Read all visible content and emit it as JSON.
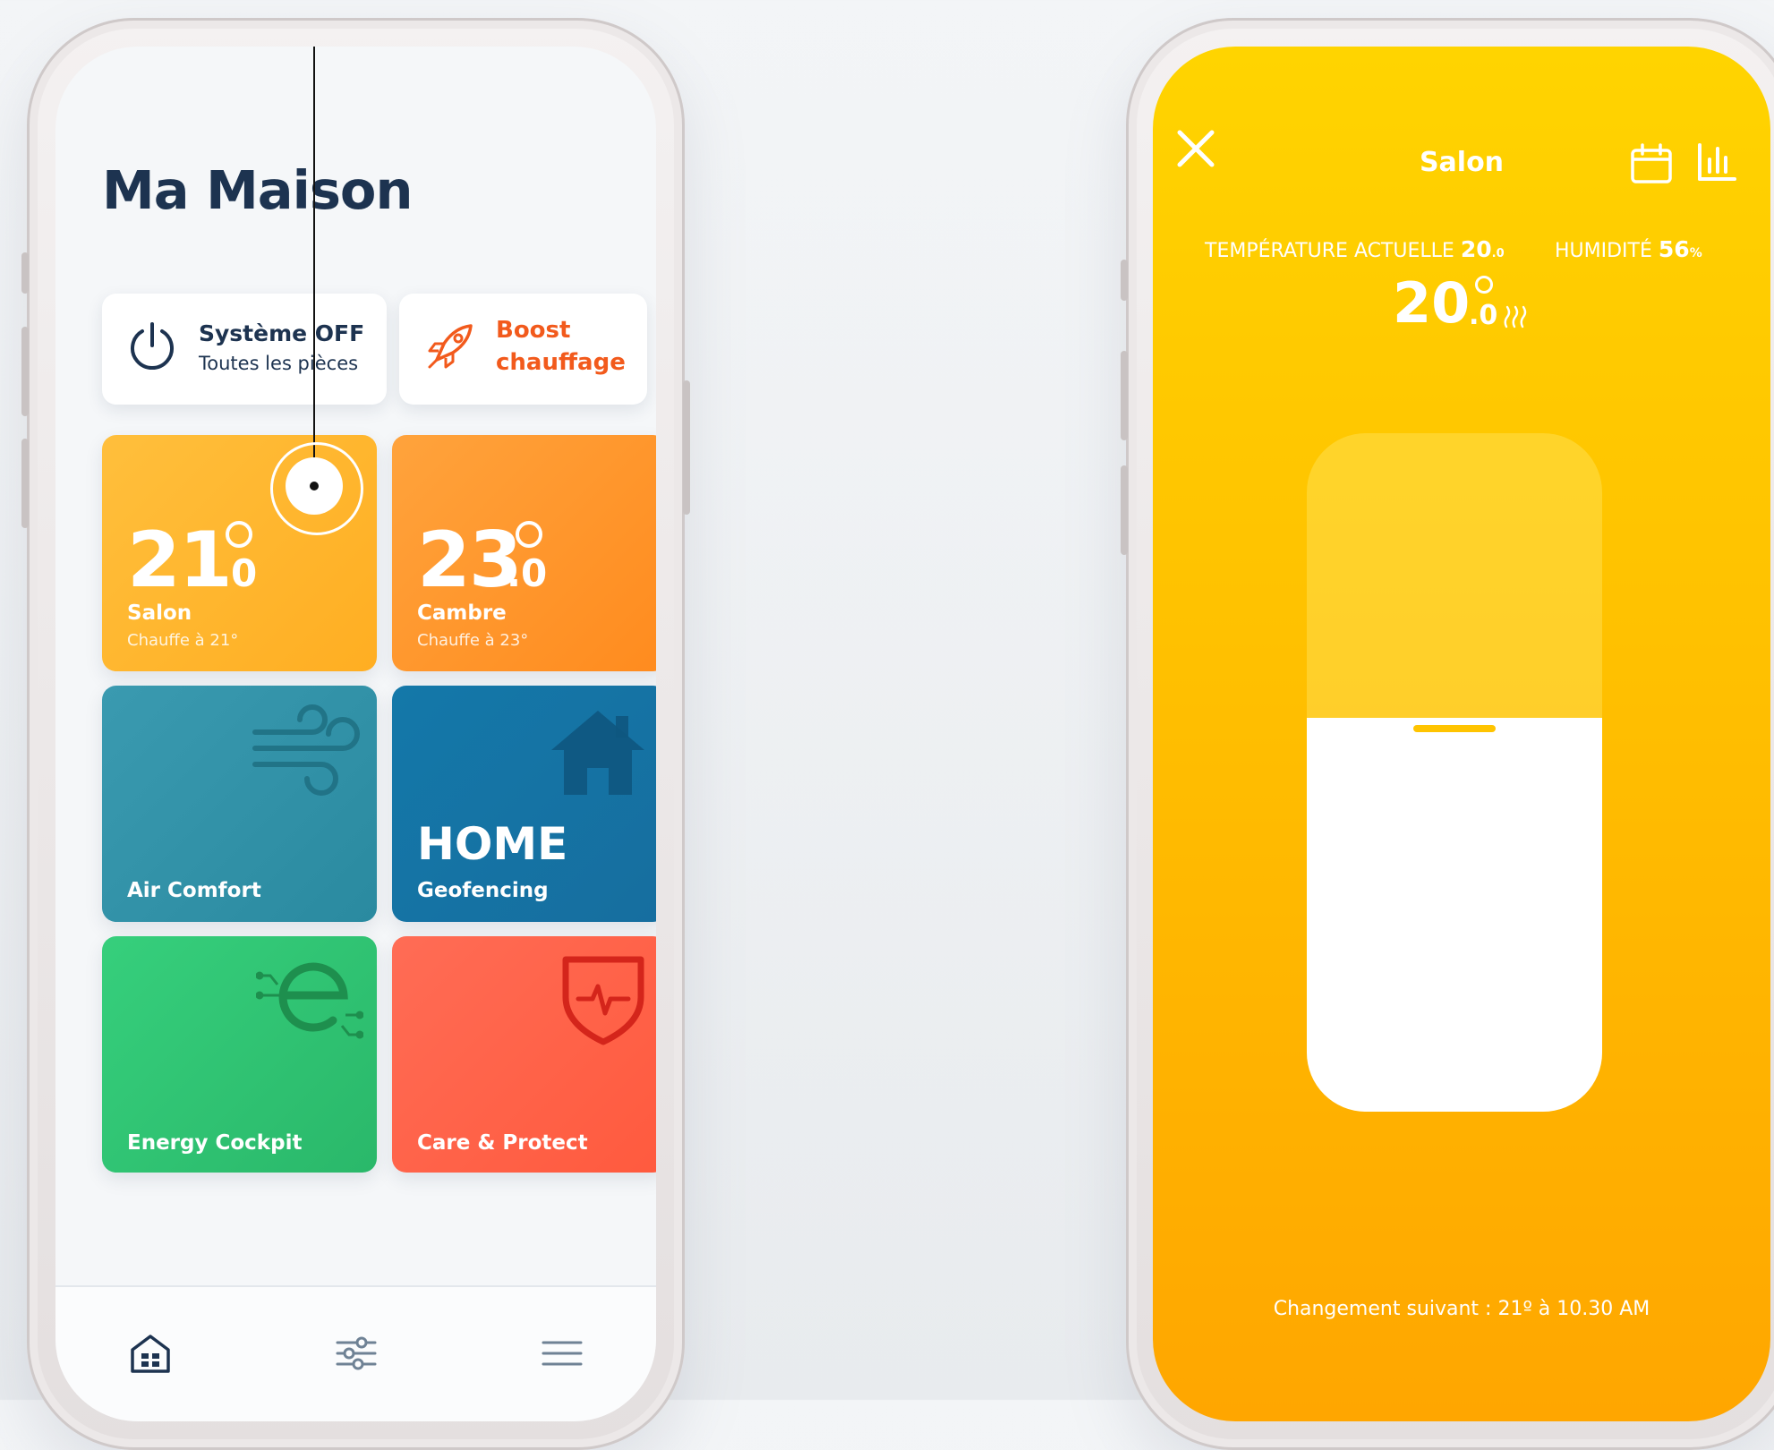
{
  "home": {
    "title": "Ma Maison",
    "system_button": {
      "title": "Système OFF",
      "subtitle": "Toutes les pièces",
      "icon": "power-icon"
    },
    "boost_button": {
      "line1": "Boost",
      "line2": "chauffage",
      "icon": "rocket-icon",
      "color": "#f25a1c"
    },
    "rooms": [
      {
        "temp": "21",
        "decimal": ".0",
        "name": "Salon",
        "status": "Chauffe à 21°",
        "color": "#ffb82f"
      },
      {
        "temp": "23",
        "decimal": ".0",
        "name": "Cambre",
        "status": "Chauffe à 23°",
        "color": "#ff972c"
      }
    ],
    "features": [
      {
        "name": "Air Comfort",
        "icon": "wind-icon",
        "color": "#3392a8"
      },
      {
        "headline": "HOME",
        "name": "Geofencing",
        "icon": "house-icon",
        "color": "#1573a4"
      },
      {
        "name": "Energy Cockpit",
        "icon": "energy-e-icon",
        "color": "#31c474"
      },
      {
        "name": "Care & Protect",
        "icon": "shield-pulse-icon",
        "color": "#ff6349"
      }
    ],
    "tabbar": [
      "home-grid-icon",
      "sliders-icon",
      "menu-icon"
    ]
  },
  "room_detail": {
    "title": "Salon",
    "current_label": "TEMPÉRATURE ACTUELLE",
    "current_value": "20",
    "current_decimal": ".0",
    "humidity_label": "HUMIDITÉ",
    "humidity_value": "56",
    "humidity_unit": "%",
    "setpoint": "20",
    "setpoint_decimal": ".0",
    "slider_level": 0.58,
    "next_change": "Changement suivant : 21º à 10.30 AM",
    "icons": [
      "close-icon",
      "calendar-icon",
      "bar-chart-icon",
      "heating-icon"
    ]
  }
}
